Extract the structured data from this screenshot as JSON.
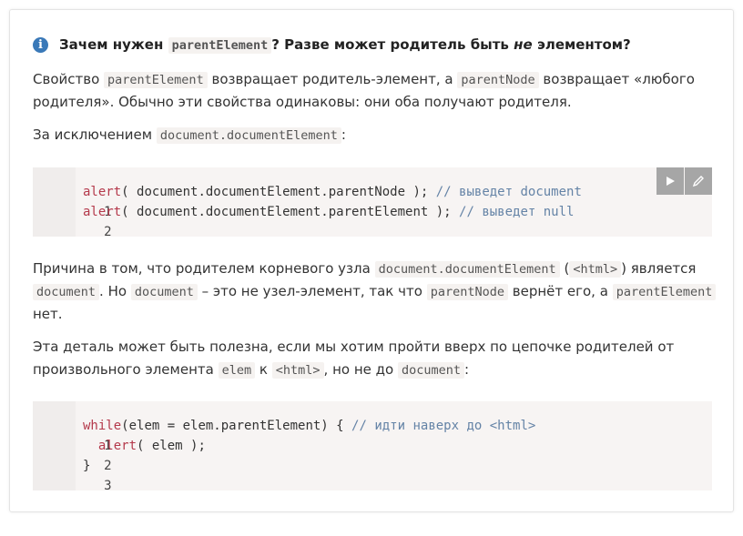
{
  "title": {
    "before": "Зачем нужен",
    "code": "parentElement",
    "middle": "? Разве может родитель быть",
    "emph": "не",
    "after": "элементом?"
  },
  "p1": {
    "l1_t1": "Свойство",
    "l1_c1": "parentElement",
    "l1_t2": "возвращает родитель-элемент, а",
    "l1_c2": "parentNode",
    "l1_t3": "возвращает «любого",
    "l2": "родителя». Обычно эти свойства одинаковы: они оба получают родителя."
  },
  "p2": {
    "t1": "За исключением",
    "c1": "document.documentElement",
    "t2": ":"
  },
  "code1": {
    "lines": [
      {
        "num": "1",
        "kw": "alert",
        "body": "( document.documentElement.parentNode );",
        "comment": "// выведет document"
      },
      {
        "num": "2",
        "kw": "alert",
        "body": "( document.documentElement.parentElement );",
        "comment": "// выведет null"
      }
    ],
    "run_icon": "play-icon",
    "edit_icon": "pencil-icon"
  },
  "p3": {
    "l1_t1": "Причина в том, что родителем корневого узла",
    "l1_c1": "document.documentElement",
    "l1_t2": "(",
    "l1_c2": "<html>",
    "l1_t3": ") является",
    "l2_c1": "document",
    "l2_t1": ". Но",
    "l2_c2": "document",
    "l2_t2": "– это не узел-элемент, так что",
    "l2_c3": "parentNode",
    "l2_t3": "вернёт его, а",
    "l2_c4": "parentElement",
    "l3": "нет."
  },
  "p4": {
    "l1": "Эта деталь может быть полезна, если мы хотим пройти вверх по цепочке родителей от",
    "l2_t1": "произвольного элемента",
    "l2_c1": "elem",
    "l2_t2": "к",
    "l2_c2": "<html>",
    "l2_t3": ", но не до",
    "l2_c3": "document",
    "l2_t4": ":"
  },
  "code2": {
    "lines": [
      {
        "num": "1",
        "kw": "while",
        "body": "(elem = elem.parentElement) {",
        "comment": "// идти наверх до <html>"
      },
      {
        "num": "2",
        "indent": "  ",
        "kw": "alert",
        "body": "( elem );",
        "comment": ""
      },
      {
        "num": "3",
        "kw": "",
        "body": "}",
        "comment": ""
      }
    ]
  },
  "colors": {
    "accent": "#3a79b8",
    "keyword": "#b4394b",
    "comment": "#6483a6",
    "code_bg": "#f7f4f3"
  }
}
